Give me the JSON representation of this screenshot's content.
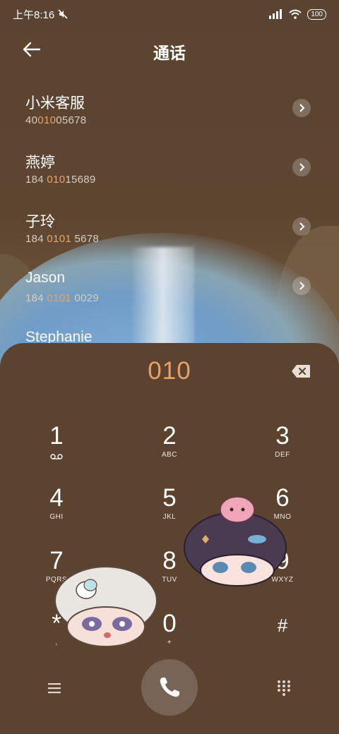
{
  "status": {
    "time": "上午8:16",
    "battery": "100"
  },
  "header": {
    "title": "通话"
  },
  "contacts": [
    {
      "name": "小米客服",
      "num_pre": "40",
      "num_hl": "010",
      "num_post": "05678"
    },
    {
      "name": "燕婷",
      "num_pre": "184 ",
      "num_hl": "010",
      "num_post": "15689"
    },
    {
      "name": "子玲",
      "num_pre": "184 ",
      "num_hl": "0101",
      "num_post": " 5678"
    },
    {
      "name": "Jason",
      "num_pre": "184 ",
      "num_hl": "0101",
      "num_post": " 0029"
    },
    {
      "name": "Stephanie",
      "num_pre": "",
      "num_hl": "",
      "num_post": ""
    }
  ],
  "dialer": {
    "entry": "010",
    "keys": [
      {
        "digit": "1",
        "letters": ""
      },
      {
        "digit": "2",
        "letters": "ABC"
      },
      {
        "digit": "3",
        "letters": "DEF"
      },
      {
        "digit": "4",
        "letters": "GHI"
      },
      {
        "digit": "5",
        "letters": "JKL"
      },
      {
        "digit": "6",
        "letters": "MNO"
      },
      {
        "digit": "7",
        "letters": "PQRS"
      },
      {
        "digit": "8",
        "letters": "TUV"
      },
      {
        "digit": "9",
        "letters": "WXYZ"
      },
      {
        "digit": "*",
        "letters": ","
      },
      {
        "digit": "0",
        "letters": "+"
      },
      {
        "digit": "#",
        "letters": ""
      }
    ]
  },
  "colors": {
    "accent": "#e8a064",
    "background": "#5b4330"
  },
  "icons": {
    "back": "arrow-left-icon",
    "chevron": "chevron-right-icon",
    "backspace": "backspace-icon",
    "voicemail": "voicemail-icon",
    "menu": "menu-icon",
    "call": "phone-icon",
    "keypad": "keypad-icon",
    "wifi": "wifi-icon",
    "signal": "signal-icon",
    "mute": "mute-icon"
  }
}
